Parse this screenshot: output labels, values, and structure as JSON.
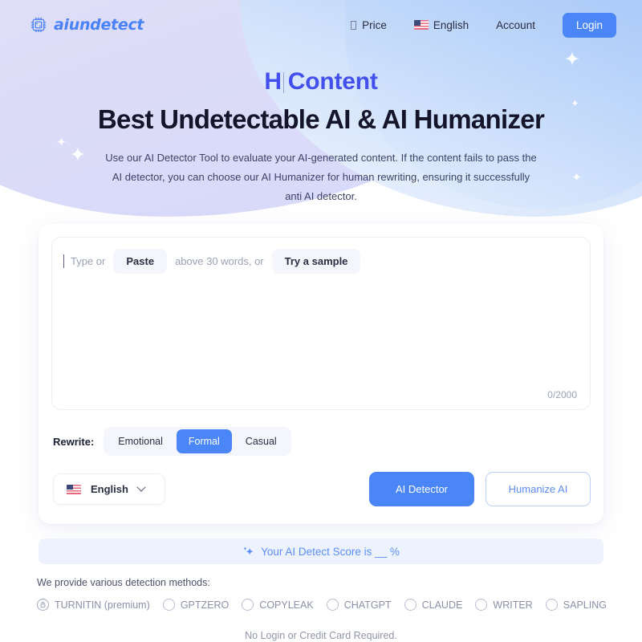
{
  "header": {
    "brand_name": "aiundetect",
    "brand_icon": "chip-icon",
    "nav": [
      {
        "id": "price",
        "label": "Price",
        "icon": "tofu-glyph"
      },
      {
        "id": "language",
        "label": "English",
        "icon": "us-flag-icon"
      },
      {
        "id": "account",
        "label": "Account",
        "icon": ""
      }
    ],
    "login_label": "Login"
  },
  "hero": {
    "typewriter_text": "H",
    "typewriter_suffix": "Content",
    "title": "Best Undetectable AI & AI Humanizer",
    "description": "Use our AI Detector Tool to evaluate your AI-generated content. If the content fails to pass the AI detector, you can choose our AI Humanizer for human rewriting, ensuring it successfully anti AI detector."
  },
  "editor": {
    "placeholder_prefix": "Type or",
    "paste_label": "Paste",
    "placeholder_middle": "above 30 words, or",
    "sample_label": "Try a sample",
    "char_count": "0/2000"
  },
  "rewrite": {
    "label": "Rewrite:",
    "tones": [
      {
        "id": "emotional",
        "label": "Emotional",
        "active": false
      },
      {
        "id": "formal",
        "label": "Formal",
        "active": true
      },
      {
        "id": "casual",
        "label": "Casual",
        "active": false
      }
    ]
  },
  "actions": {
    "language_value": "English",
    "language_icon": "us-flag-icon",
    "chevron_icon": "chevron-down-icon",
    "detector_label": "AI Detector",
    "humanize_label": "Humanize AI"
  },
  "score": {
    "icon": "sparkle-icon",
    "text": "Your AI Detect Score is __ %"
  },
  "methods": {
    "label": "We provide various detection methods:",
    "items": [
      {
        "id": "turnitin",
        "label": "TURNITIN (premium)",
        "locked": true
      },
      {
        "id": "gptzero",
        "label": "GPTZERO",
        "locked": false
      },
      {
        "id": "copyleak",
        "label": "COPYLEAK",
        "locked": false
      },
      {
        "id": "chatgpt",
        "label": "CHATGPT",
        "locked": false
      },
      {
        "id": "claude",
        "label": "CLAUDE",
        "locked": false
      },
      {
        "id": "writer",
        "label": "WRITER",
        "locked": false
      },
      {
        "id": "sapling",
        "label": "SAPLING",
        "locked": false
      }
    ]
  },
  "footer": {
    "note": "No Login or Credit Card Required."
  },
  "colors": {
    "accent_blue": "#4a86f7",
    "typewriter_blue": "#4450ee",
    "lavender_blob": "#dcdcf8",
    "banner_bg": "#edf3fe"
  }
}
